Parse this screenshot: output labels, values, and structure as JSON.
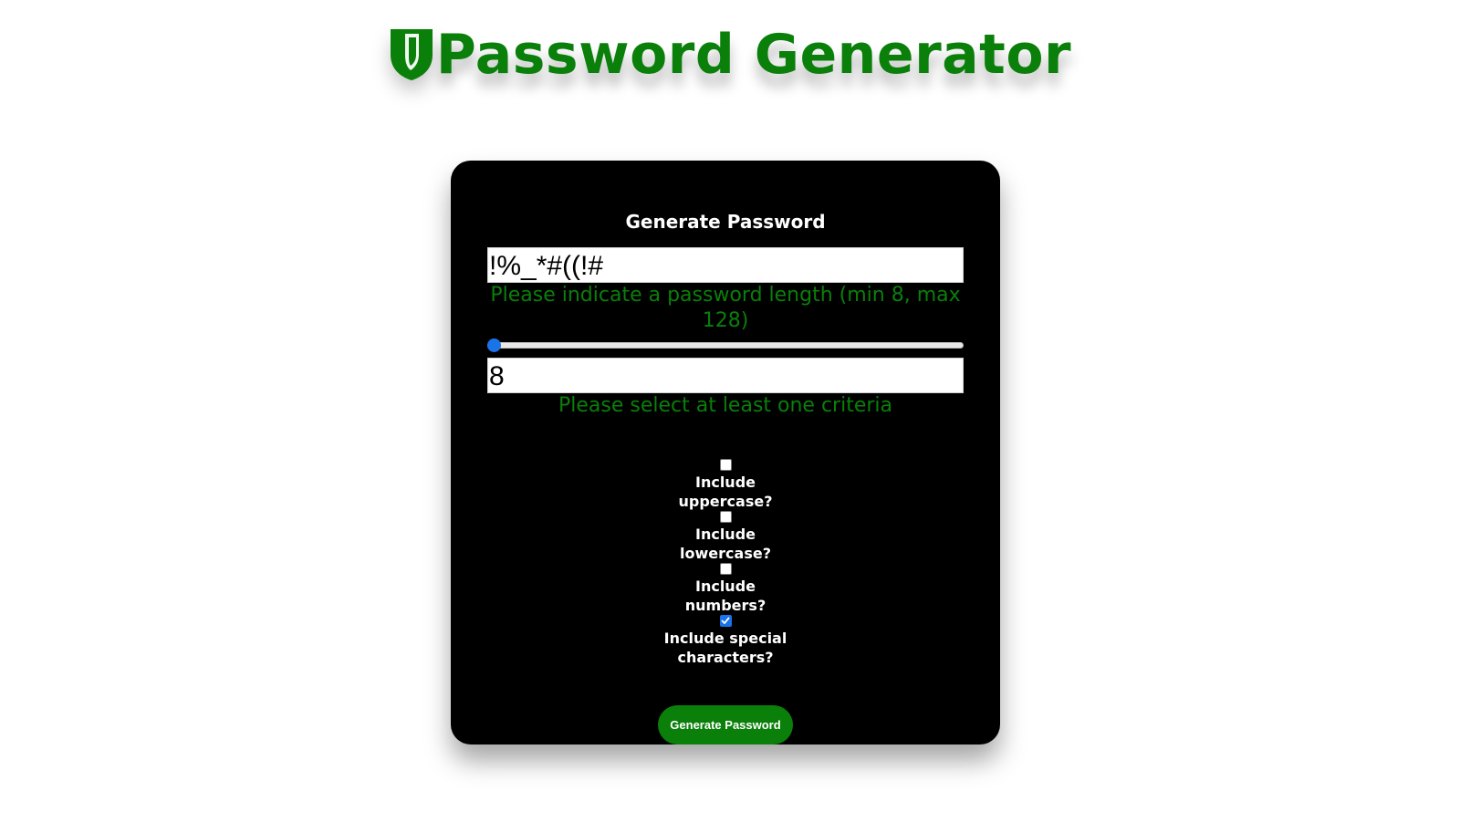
{
  "header": {
    "title": "Password Generator",
    "logo_icon": "shield-icon",
    "brand_color": "#0a7f0a"
  },
  "card": {
    "title": "Generate Password",
    "password_output": "!%_*#((!#",
    "length_hint": "Please indicate a password length (min 8, max 128)",
    "length_slider": {
      "value": 8,
      "min": 8,
      "max": 128,
      "accent_color": "#1a73e8"
    },
    "length_value": "8",
    "criteria_hint": "Please select at least one criteria",
    "criteria": [
      {
        "label": "Include uppercase?",
        "checked": false
      },
      {
        "label": "Include lowercase?",
        "checked": false
      },
      {
        "label": "Include numbers?",
        "checked": false
      },
      {
        "label": "Include special characters?",
        "checked": true
      }
    ],
    "generate_button": "Generate Password"
  }
}
